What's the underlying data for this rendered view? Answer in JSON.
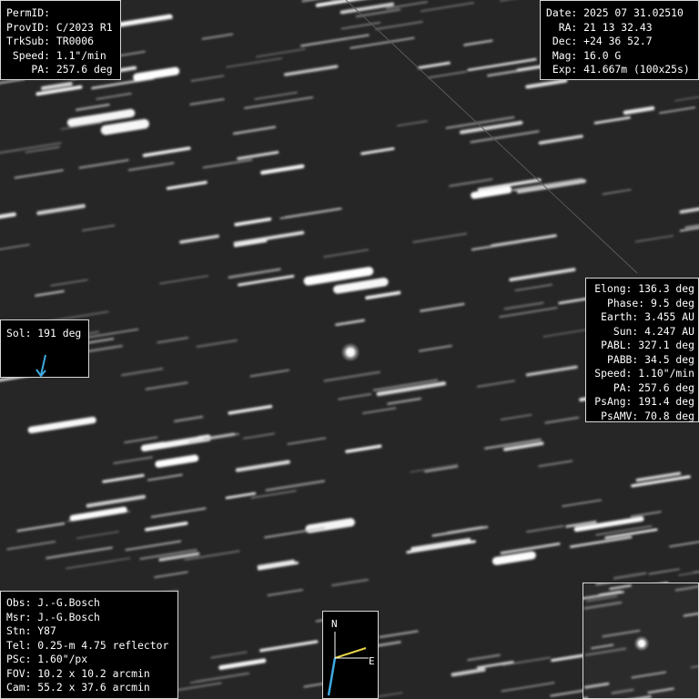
{
  "colors": {
    "sky": "#262626",
    "panel_bg": "#000000",
    "panel_border": "#d8d8d8",
    "text": "#ffffff",
    "sol_arrow": "#3fa9e0",
    "compass_east": "#e8d44a",
    "compass_north": "#3fa9e0"
  },
  "top_left": {
    "rows": [
      "PermID:",
      "ProvID: C/2023 R1",
      "TrkSub: TR0006",
      " Speed: 1.1\"/min",
      "    PA: 257.6 deg"
    ]
  },
  "top_right": {
    "rows": [
      "Date: 2025 07 31.02510",
      "  RA: 21 13 32.43",
      " Dec: +24 36 52.7",
      " Mag: 16.0 G",
      " Exp: 41.667m (100x25s)"
    ]
  },
  "right": {
    "rows": [
      "Elong: 136.3 deg",
      "Phase: 9.5 deg",
      "Earth: 3.455 AU",
      "Sun: 4.247 AU",
      "PABL: 327.1 deg",
      "PABB: 34.5 deg",
      "Speed: 1.10\"/min",
      "PA: 257.6 deg",
      "PsAng: 191.4 deg",
      "PsAMV: 70.8 deg"
    ]
  },
  "sol": {
    "label": "Sol: 191 deg",
    "icon": "arrow-icon"
  },
  "bottom_left": {
    "rows": [
      "Obs: J.-G.Bosch",
      "Msr: J.-G.Bosch",
      "Stn: Y87",
      "Tel: 0.25-m 4.75 reflector",
      "PSc: 1.60\"/px",
      "FOV: 10.2 x 10.2 arcmin",
      "Cam: 55.2 x 37.6 arcmin"
    ]
  },
  "compass": {
    "north": "N",
    "east": "E"
  }
}
